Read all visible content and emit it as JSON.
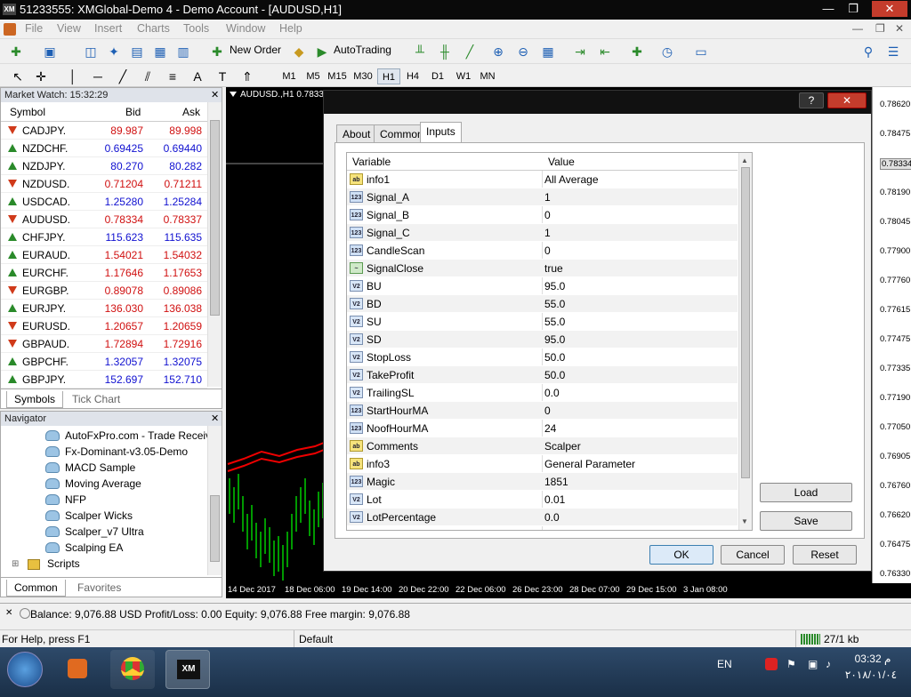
{
  "window": {
    "title": "51233555: XMGlobal-Demo 4 - Demo Account - [AUDUSD,H1]",
    "icon": "XM",
    "min": "—",
    "restore": "❐",
    "close": "✕"
  },
  "menu": {
    "items": [
      "File",
      "View",
      "Insert",
      "Charts",
      "Tools",
      "Window",
      "Help"
    ]
  },
  "toolbar": {
    "new_order": "New Order",
    "autotrading": "AutoTrading",
    "timeframes": [
      "M1",
      "M5",
      "M15",
      "M30",
      "H1",
      "H4",
      "D1",
      "W1",
      "MN"
    ],
    "selected_tf": "H1"
  },
  "market_watch": {
    "title": "Market Watch: 15:32:29",
    "col_symbol": "Symbol",
    "col_bid": "Bid",
    "col_ask": "Ask",
    "rows": [
      {
        "symbol": "CADJPY.",
        "bid": "89.987",
        "ask": "89.998",
        "dir": "down",
        "color": "red"
      },
      {
        "symbol": "NZDCHF.",
        "bid": "0.69425",
        "ask": "0.69440",
        "dir": "up",
        "color": "blue"
      },
      {
        "symbol": "NZDJPY.",
        "bid": "80.270",
        "ask": "80.282",
        "dir": "up",
        "color": "blue"
      },
      {
        "symbol": "NZDUSD.",
        "bid": "0.71204",
        "ask": "0.71211",
        "dir": "down",
        "color": "red"
      },
      {
        "symbol": "USDCAD.",
        "bid": "1.25280",
        "ask": "1.25284",
        "dir": "up",
        "color": "blue"
      },
      {
        "symbol": "AUDUSD.",
        "bid": "0.78334",
        "ask": "0.78337",
        "dir": "down",
        "color": "red"
      },
      {
        "symbol": "CHFJPY.",
        "bid": "115.623",
        "ask": "115.635",
        "dir": "up",
        "color": "blue"
      },
      {
        "symbol": "EURAUD.",
        "bid": "1.54021",
        "ask": "1.54032",
        "dir": "up",
        "color": "red"
      },
      {
        "symbol": "EURCHF.",
        "bid": "1.17646",
        "ask": "1.17653",
        "dir": "up",
        "color": "red"
      },
      {
        "symbol": "EURGBP.",
        "bid": "0.89078",
        "ask": "0.89086",
        "dir": "down",
        "color": "red"
      },
      {
        "symbol": "EURJPY.",
        "bid": "136.030",
        "ask": "136.038",
        "dir": "up",
        "color": "red"
      },
      {
        "symbol": "EURUSD.",
        "bid": "1.20657",
        "ask": "1.20659",
        "dir": "down",
        "color": "red"
      },
      {
        "symbol": "GBPAUD.",
        "bid": "1.72894",
        "ask": "1.72916",
        "dir": "down",
        "color": "red"
      },
      {
        "symbol": "GBPCHF.",
        "bid": "1.32057",
        "ask": "1.32075",
        "dir": "up",
        "color": "blue"
      },
      {
        "symbol": "GBPJPY.",
        "bid": "152.697",
        "ask": "152.710",
        "dir": "up",
        "color": "blue"
      }
    ],
    "tabs": [
      "Symbols",
      "Tick Chart"
    ]
  },
  "navigator": {
    "title": "Navigator",
    "items": [
      "AutoFxPro.com - Trade Receiv",
      "Fx-Dominant-v3.05-Demo",
      "MACD Sample",
      "Moving Average",
      "NFP",
      "Scalper Wicks",
      "Scalper_v7 Ultra",
      "Scalping EA"
    ],
    "scripts": "Scripts",
    "tabs": [
      "Common",
      "Favorites"
    ]
  },
  "chart": {
    "title": "AUDUSD.,H1  0.7833",
    "prices": [
      "0.78620",
      "0.78475",
      "0.78334",
      "0.78190",
      "0.78045",
      "0.77900",
      "0.77760",
      "0.77615",
      "0.77475",
      "0.77335",
      "0.77190",
      "0.77050",
      "0.76905",
      "0.76760",
      "0.76620",
      "0.76475",
      "0.76330"
    ],
    "current_price": "0.78334",
    "times": [
      "14 Dec 2017",
      "18 Dec 06:00",
      "19 Dec 14:00",
      "20 Dec 22:00",
      "22 Dec 06:00",
      "26 Dec 23:00",
      "28 Dec 07:00",
      "29 Dec 15:00",
      "3 Jan 08:00"
    ]
  },
  "dialog": {
    "help": "?",
    "close": "✕",
    "tabs": [
      "About",
      "Common",
      "Inputs"
    ],
    "col_variable": "Variable",
    "col_value": "Value",
    "params": [
      {
        "type": "ab",
        "name": "info1",
        "value": "All Average"
      },
      {
        "type": "123",
        "name": "Signal_A",
        "value": "1"
      },
      {
        "type": "123",
        "name": "Signal_B",
        "value": "0"
      },
      {
        "type": "123",
        "name": "Signal_C",
        "value": "1"
      },
      {
        "type": "123",
        "name": "CandleScan",
        "value": "0"
      },
      {
        "type": "sig",
        "name": "SignalClose",
        "value": "true"
      },
      {
        "type": "v12",
        "name": "BU",
        "value": "95.0"
      },
      {
        "type": "v12",
        "name": "BD",
        "value": "55.0"
      },
      {
        "type": "v12",
        "name": "SU",
        "value": "55.0"
      },
      {
        "type": "v12",
        "name": "SD",
        "value": "95.0"
      },
      {
        "type": "v12",
        "name": "StopLoss",
        "value": "50.0"
      },
      {
        "type": "v12",
        "name": "TakeProfit",
        "value": "50.0"
      },
      {
        "type": "v12",
        "name": "TrailingSL",
        "value": "0.0"
      },
      {
        "type": "123",
        "name": "StartHourMA",
        "value": "0"
      },
      {
        "type": "123",
        "name": "NoofHourMA",
        "value": "24"
      },
      {
        "type": "ab",
        "name": "Comments",
        "value": "Scalper"
      },
      {
        "type": "ab",
        "name": "info3",
        "value": "General Parameter"
      },
      {
        "type": "123",
        "name": "Magic",
        "value": "1851"
      },
      {
        "type": "v12",
        "name": "Lot",
        "value": "0.01"
      },
      {
        "type": "v12",
        "name": "LotPercentage",
        "value": "0.0"
      }
    ],
    "icon_labels": {
      "ab": "ab",
      "123": "123",
      "v12": "V2",
      "sig": "~"
    },
    "load": "Load",
    "save": "Save",
    "ok": "OK",
    "cancel": "Cancel",
    "reset": "Reset"
  },
  "balance": {
    "text": "Balance: 9,076.88 USD  Profit/Loss: 0.00  Equity: 9,076.88  Free margin: 9,076.88"
  },
  "status": {
    "help": "For Help, press F1",
    "profile": "Default",
    "traffic": "27/1 kb"
  },
  "taskbar": {
    "lang": "EN",
    "time": "03:32 م",
    "date": "٢٠١٨/٠١/٠٤"
  }
}
